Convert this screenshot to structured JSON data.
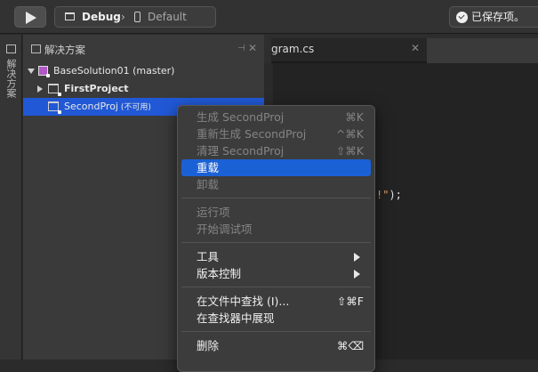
{
  "toolbar": {
    "config": "Debug",
    "config_sep": "›",
    "target": "Default",
    "status": "已保存项。"
  },
  "strip": {
    "label": "解决方案"
  },
  "pad": {
    "title": "解决方案",
    "pin": "⊣",
    "close": "✕",
    "tree": [
      {
        "label": "BaseSolution01 (master)"
      },
      {
        "label": "FirstProject"
      },
      {
        "label": "SecondProj",
        "sub": " (不可用)"
      }
    ]
  },
  "editor": {
    "tab_label": "gram.cs",
    "tab_close": "✕",
    "code_str": "!\"",
    "code_punc": ");"
  },
  "menu": {
    "items": [
      {
        "label": "生成 SecondProj",
        "shortcut": "⌘K"
      },
      {
        "label": "重新生成 SecondProj",
        "shortcut": "^⌘K"
      },
      {
        "label": "清理 SecondProj",
        "shortcut": "⇧⌘K"
      },
      {
        "label": "重载",
        "shortcut": ""
      },
      {
        "label": "卸载",
        "shortcut": ""
      },
      {
        "label": "运行项",
        "shortcut": ""
      },
      {
        "label": "开始调试项",
        "shortcut": ""
      },
      {
        "label": "工具",
        "shortcut": ""
      },
      {
        "label": "版本控制",
        "shortcut": ""
      },
      {
        "label": "在文件中查找 (I)...",
        "shortcut": "⇧⌘F"
      },
      {
        "label": "在查找器中展现",
        "shortcut": ""
      },
      {
        "label": "删除",
        "shortcut": "⌘⌫"
      }
    ]
  }
}
